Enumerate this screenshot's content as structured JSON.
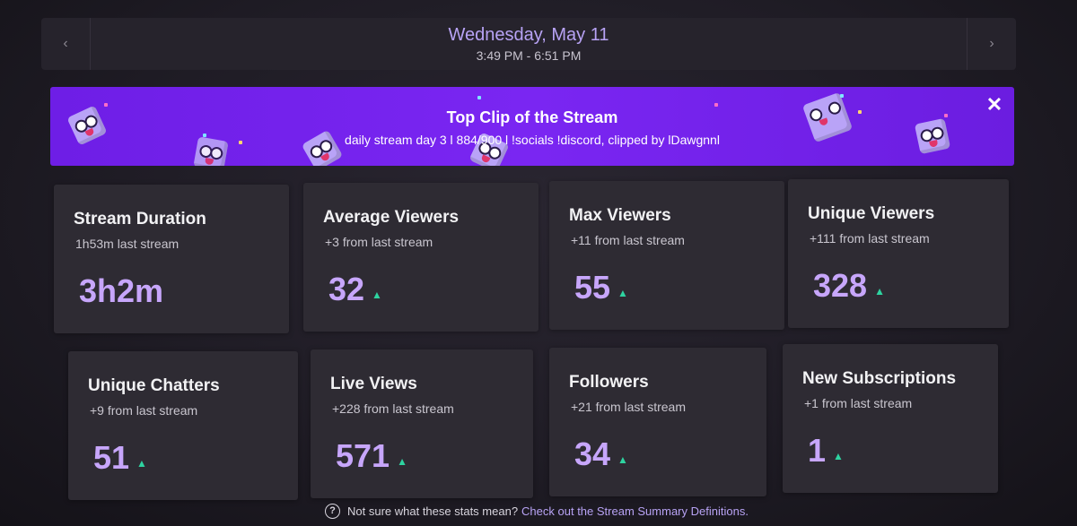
{
  "date_bar": {
    "date": "Wednesday, May 11",
    "time_range": "3:49 PM - 6:51 PM",
    "prev_icon": "chevron-left-icon",
    "next_icon": "chevron-right-icon"
  },
  "clip_banner": {
    "title": "Top Clip of the Stream",
    "subtitle": "daily stream day 3 l 884/900 l !socials !discord, clipped by lDawgnnl",
    "close_icon": "close-icon",
    "accent_color": "#7a26f2"
  },
  "stats": [
    {
      "title": "Stream Duration",
      "sub": "1h53m last stream",
      "value": "3h2m",
      "trend_up": false
    },
    {
      "title": "Average Viewers",
      "sub": "+3 from last stream",
      "value": "32",
      "trend_up": true
    },
    {
      "title": "Max Viewers",
      "sub": "+11 from last stream",
      "value": "55",
      "trend_up": true
    },
    {
      "title": "Unique Viewers",
      "sub": "+111 from last stream",
      "value": "328",
      "trend_up": true
    },
    {
      "title": "Unique Chatters",
      "sub": "+9 from last stream",
      "value": "51",
      "trend_up": true
    },
    {
      "title": "Live Views",
      "sub": "+228 from last stream",
      "value": "571",
      "trend_up": true
    },
    {
      "title": "Followers",
      "sub": "+21 from last stream",
      "value": "34",
      "trend_up": true
    },
    {
      "title": "New Subscriptions",
      "sub": "+1 from last stream",
      "value": "1",
      "trend_up": true
    }
  ],
  "footer": {
    "question": "Not sure what these stats mean?",
    "link": "Check out the Stream Summary Definitions.",
    "help_icon": "question-circle-icon"
  },
  "colors": {
    "value": "#c7a6fb",
    "trend_up": "#2ed3a0",
    "card_bg": "#2e2b33"
  }
}
